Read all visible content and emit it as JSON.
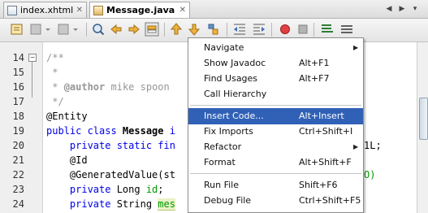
{
  "tabs": [
    {
      "label": "index.xhtml",
      "close": "✕",
      "active": false
    },
    {
      "label": "Message.java",
      "close": "✕",
      "active": true
    }
  ],
  "tab_nav": {
    "left": "◀",
    "right": "▶",
    "list": "▾"
  },
  "toolbar_icons": [
    "history-icon",
    "back-icon",
    "forward-icon",
    "find-icon",
    "find-prev-icon",
    "find-next-icon",
    "toggle-highlight-icon",
    "shift-up-icon",
    "shift-down-icon",
    "toggle-bookmark-icon",
    "shift-left-icon",
    "shift-right-icon",
    "record-macro-icon",
    "stop-macro-icon",
    "start-test-icon",
    "comment-icon"
  ],
  "line_numbers": [
    "14",
    "15",
    "16",
    "17",
    "18",
    "19",
    "20",
    "21",
    "22",
    "23",
    "24"
  ],
  "code": {
    "l14": "/**",
    "l15": " *",
    "l16_prefix": " * ",
    "l16_tag": "@author",
    "l16_rest": " mike spoon",
    "l17": " */",
    "l18": "@Entity",
    "l19_kw": "public class ",
    "l19_name": "Message",
    "l19_tail": " i",
    "l20_kw": "    private static fin",
    "l20_right": "1L;",
    "l21": "    @Id",
    "l22_ann": "    @GeneratedValue(st",
    "l22_right": "O)",
    "l23_kw": "    private ",
    "l23_type": "Long ",
    "l23_field": "id",
    "l23_end": ";",
    "l24_kw": "    private ",
    "l24_type": "String ",
    "l24_field": "mes"
  },
  "menu": {
    "items": [
      {
        "label": "Navigate",
        "shortcut": "",
        "submenu": true
      },
      {
        "label": "Show Javadoc",
        "shortcut": "Alt+F1"
      },
      {
        "label": "Find Usages",
        "shortcut": "Alt+F7"
      },
      {
        "label": "Call Hierarchy",
        "shortcut": ""
      },
      {
        "label": "Insert Code...",
        "shortcut": "Alt+Insert",
        "active": true
      },
      {
        "label": "Fix Imports",
        "shortcut": "Ctrl+Shift+I"
      },
      {
        "label": "Refactor",
        "shortcut": "",
        "submenu": true
      },
      {
        "label": "Format",
        "shortcut": "Alt+Shift+F"
      },
      {
        "label": "Run File",
        "shortcut": "Shift+F6"
      },
      {
        "label": "Debug File",
        "shortcut": "Ctrl+Shift+F5"
      }
    ],
    "submenu_arrow": "▶"
  },
  "colors": {
    "menu_highlight": "#3161b6",
    "keyword": "#0000e6",
    "comment": "#969696",
    "field": "#009900",
    "current_line": "#e9eff8"
  }
}
